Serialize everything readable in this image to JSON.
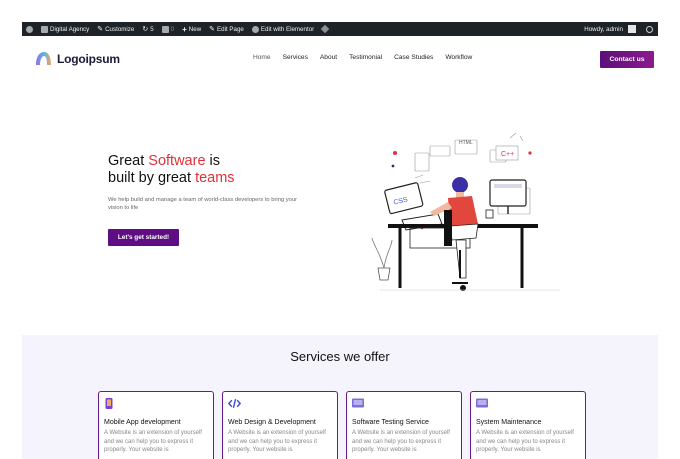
{
  "admin_bar": {
    "site_name": "Digital Agency",
    "customize": "Customize",
    "updates_count": "5",
    "comments_count": "0",
    "new_label": "New",
    "edit_page": "Edit Page",
    "edit_with_elementor": "Edit with Elementor",
    "howdy": "Howdy, admin"
  },
  "header": {
    "logo_text": "Logoipsum",
    "nav": [
      "Home",
      "Services",
      "About",
      "Testimonial",
      "Case Studies",
      "Workflow"
    ],
    "contact_button": "Contact us"
  },
  "hero": {
    "title_part1": "Great ",
    "title_highlight1": "Software",
    "title_part2": " is",
    "title_part3": "built by great ",
    "title_highlight2": "teams",
    "subtitle": "We help build and manage a team of world-class developers to bring your vision to life",
    "cta_label": "Let's get started!",
    "illustration_labels": {
      "css": "CSS",
      "html": "HTML",
      "cpp": "C++"
    }
  },
  "services": {
    "title": "Services we offer",
    "cards": [
      {
        "title": "Mobile App development",
        "text": "A Website is an extension of yourself and we can help you to express it properly. Your website is",
        "icon": "mobile-icon"
      },
      {
        "title": "Web Design & Development",
        "text": "A Website is an extension of yourself and we can help you to express it properly. Your website is",
        "icon": "code-icon"
      },
      {
        "title": "Software Testing Service",
        "text": "A Website is an extension of yourself and we can help you to express it properly. Your website is",
        "icon": "testing-icon"
      },
      {
        "title": "System Maintenance",
        "text": "A Website is an extension of yourself and we can help you to express it properly. Your website is",
        "icon": "maintenance-icon"
      }
    ]
  },
  "colors": {
    "admin_bar_bg": "#1d2327",
    "brand_purple": "#5e0d82",
    "highlight_red": "#e0303a",
    "services_bg": "#f5f3fb"
  }
}
